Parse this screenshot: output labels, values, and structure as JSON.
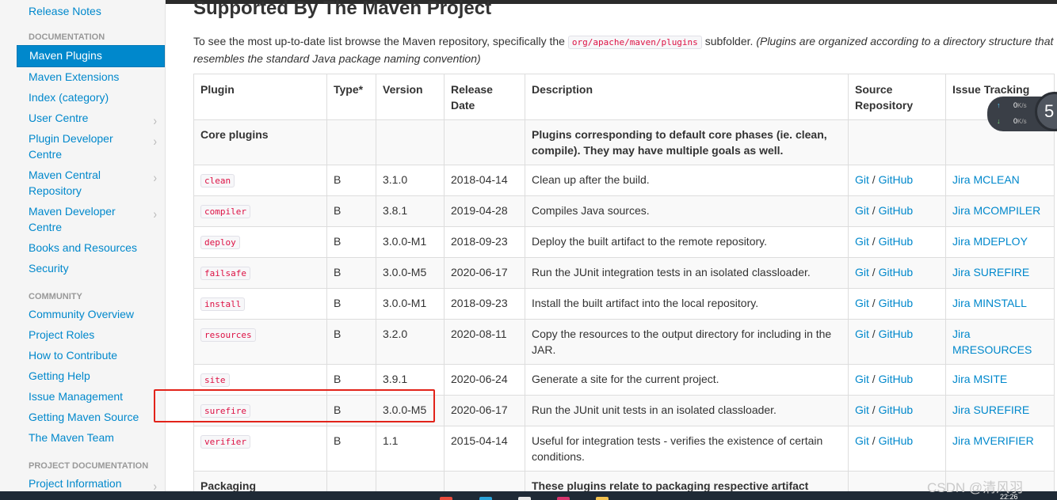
{
  "sidebar": {
    "top_link": "Release Notes",
    "documentation_header": "DOCUMENTATION",
    "documentation_items": [
      {
        "label": "Maven Plugins",
        "active": true,
        "chevron": false
      },
      {
        "label": "Maven Extensions",
        "active": false,
        "chevron": false
      },
      {
        "label": "Index (category)",
        "active": false,
        "chevron": false
      },
      {
        "label": "User Centre",
        "active": false,
        "chevron": true
      },
      {
        "label": "Plugin Developer Centre",
        "active": false,
        "chevron": true
      },
      {
        "label": "Maven Central Repository",
        "active": false,
        "chevron": true
      },
      {
        "label": "Maven Developer Centre",
        "active": false,
        "chevron": true
      },
      {
        "label": "Books and Resources",
        "active": false,
        "chevron": false
      },
      {
        "label": "Security",
        "active": false,
        "chevron": false
      }
    ],
    "community_header": "COMMUNITY",
    "community_items": [
      "Community Overview",
      "Project Roles",
      "How to Contribute",
      "Getting Help",
      "Issue Management",
      "Getting Maven Source",
      "The Maven Team"
    ],
    "project_doc_header": "PROJECT DOCUMENTATION",
    "project_doc_item": "Project Information",
    "chevron_glyph": "›"
  },
  "main": {
    "title": "Supported By The Maven Project",
    "intro_before": "To see the most up-to-date list browse the Maven repository, specifically the ",
    "intro_code": "org/apache/maven/plugins",
    "intro_after": " subfolder. ",
    "intro_italic": "(Plugins are organized according to a directory structure that resembles the standard Java package naming convention)"
  },
  "table": {
    "headers": {
      "plugin": "Plugin",
      "type": "Type*",
      "version": "Version",
      "release_date": "Release Date",
      "description": "Description",
      "source": "Source Repository",
      "issue": "Issue Tracking"
    },
    "core_group": {
      "label": "Core plugins",
      "description": "Plugins corresponding to default core phases (ie. clean, compile). They may have multiple goals as well."
    },
    "rows": [
      {
        "plugin": "clean",
        "type": "B",
        "version": "3.1.0",
        "date": "2018-04-14",
        "description": "Clean up after the build.",
        "git": "Git",
        "sep": "/",
        "github": "GitHub",
        "jira": "Jira MCLEAN"
      },
      {
        "plugin": "compiler",
        "type": "B",
        "version": "3.8.1",
        "date": "2019-04-28",
        "description": "Compiles Java sources.",
        "git": "Git",
        "sep": "/",
        "github": "GitHub",
        "jira": "Jira MCOMPILER"
      },
      {
        "plugin": "deploy",
        "type": "B",
        "version": "3.0.0-M1",
        "date": "2018-09-23",
        "description": "Deploy the built artifact to the remote repository.",
        "git": "Git",
        "sep": "/",
        "github": "GitHub",
        "jira": "Jira MDEPLOY"
      },
      {
        "plugin": "failsafe",
        "type": "B",
        "version": "3.0.0-M5",
        "date": "2020-06-17",
        "description": "Run the JUnit integration tests in an isolated classloader.",
        "git": "Git",
        "sep": "/",
        "github": "GitHub",
        "jira": "Jira SUREFIRE"
      },
      {
        "plugin": "install",
        "type": "B",
        "version": "3.0.0-M1",
        "date": "2018-09-23",
        "description": "Install the built artifact into the local repository.",
        "git": "Git",
        "sep": "/",
        "github": "GitHub",
        "jira": "Jira MINSTALL"
      },
      {
        "plugin": "resources",
        "type": "B",
        "version": "3.2.0",
        "date": "2020-08-11",
        "description": "Copy the resources to the output directory for including in the JAR.",
        "git": "Git",
        "sep": "/",
        "github": "GitHub",
        "jira": "Jira MRESOURCES"
      },
      {
        "plugin": "site",
        "type": "B",
        "version": "3.9.1",
        "date": "2020-06-24",
        "description": "Generate a site for the current project.",
        "git": "Git",
        "sep": "/",
        "github": "GitHub",
        "jira": "Jira MSITE"
      },
      {
        "plugin": "surefire",
        "type": "B",
        "version": "3.0.0-M5",
        "date": "2020-06-17",
        "description": "Run the JUnit unit tests in an isolated classloader.",
        "git": "Git",
        "sep": "/",
        "github": "GitHub",
        "jira": "Jira SUREFIRE"
      },
      {
        "plugin": "verifier",
        "type": "B",
        "version": "1.1",
        "date": "2015-04-14",
        "description": "Useful for integration tests - verifies the existence of certain conditions.",
        "git": "Git",
        "sep": "/",
        "github": "GitHub",
        "jira": "Jira MVERIFIER"
      }
    ],
    "packaging_group": {
      "label": "Packaging",
      "description": "These plugins relate to packaging respective artifact"
    }
  },
  "overlay": {
    "net_up_value": "0",
    "net_up_unit": "K/s",
    "net_down_value": "0",
    "net_down_unit": "K/s",
    "net_up_arrow": "↑",
    "net_down_arrow": "↓",
    "cpu_percent": "5",
    "highlight_color": "#e2231a"
  },
  "taskbar": {
    "clock": "22:26"
  },
  "watermark": "CSDN @清风羽",
  "colors": {
    "link": "#0088cc",
    "code": "#d14",
    "active_nav": "#0088cc"
  }
}
